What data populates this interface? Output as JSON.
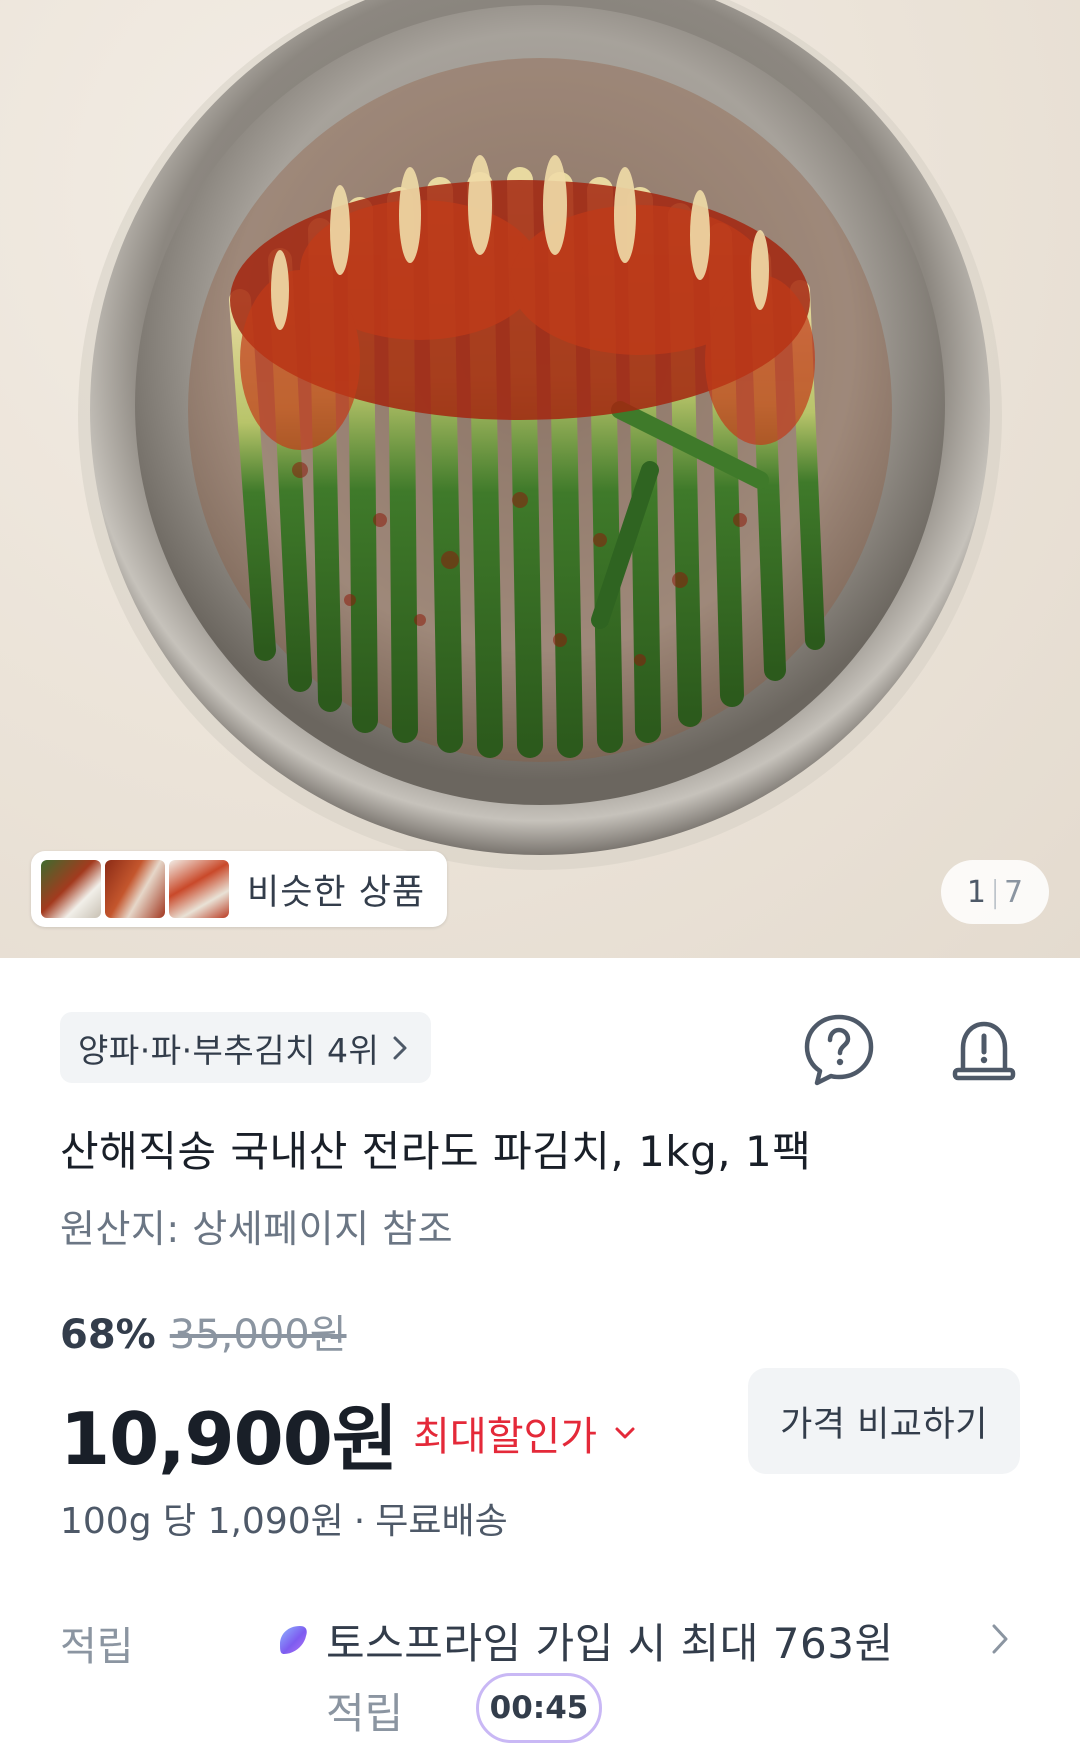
{
  "gallery": {
    "similar_label": "비슷한 상품",
    "current": "1",
    "separator": "|",
    "total": "7"
  },
  "product": {
    "rank_label": "양파·파·부추김치 4위",
    "title": "산해직송 국내산 전라도 파김치, 1kg, 1팩",
    "origin": "원산지: 상세페이지 참조",
    "discount_rate": "68%",
    "original_price": "35,000원",
    "sale_price": "10,900원",
    "max_discount_label": "최대할인가",
    "compare_button": "가격 비교하기",
    "unit_price": "100g 당 1,090원",
    "dot": "·",
    "shipping": "무료배송"
  },
  "points": {
    "label": "적립",
    "line1": "토스프라임 가입 시 최대 763원",
    "line2": "적립",
    "timer": "00:45"
  },
  "icons": {
    "question": "question-icon",
    "report": "report-bell-icon",
    "chevron": "chevron-right-icon",
    "toss_prime": "toss-prime-icon"
  },
  "colors": {
    "accent_red": "#e42939",
    "timer_border": "#c9b8f5",
    "chip_bg": "#f2f4f6"
  }
}
